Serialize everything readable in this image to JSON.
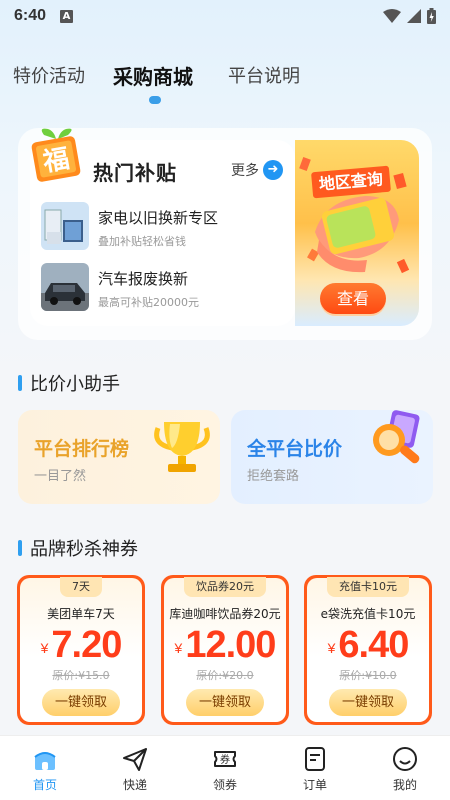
{
  "status_bar": {
    "time": "6:40",
    "badge": "A"
  },
  "tabs": [
    {
      "label": "特价活动"
    },
    {
      "label": "采购商城"
    },
    {
      "label": "平台说明"
    }
  ],
  "hot_subsidy": {
    "badge": "福",
    "title": "热门补贴",
    "more_label": "更多",
    "items": [
      {
        "title": "家电以旧换新专区",
        "subtitle": "叠加补贴轻松省钱"
      },
      {
        "title": "汽车报废换新",
        "subtitle": "最高可补贴20000元"
      }
    ],
    "region_title": "地区查询",
    "view_button": "查看"
  },
  "compare_section": {
    "title": "比价小助手",
    "cards": [
      {
        "title": "平台排行榜",
        "subtitle": "一目了然",
        "color": "#e9a32b"
      },
      {
        "title": "全平台比价",
        "subtitle": "拒绝套路",
        "color": "#2b84e8"
      }
    ]
  },
  "coupon_section": {
    "title": "品牌秒杀神券",
    "coupons": [
      {
        "tag": "7天",
        "name": "美团单车7天",
        "currency": "¥",
        "price": "7.20",
        "original": "原价:¥15.0",
        "button": "一键领取"
      },
      {
        "tag": "饮品券20元",
        "name": "库迪咖啡饮品券20元",
        "currency": "¥",
        "price": "12.00",
        "original": "原价:¥20.0",
        "button": "一键领取"
      },
      {
        "tag": "充值卡10元",
        "name": "e袋洗充值卡10元",
        "currency": "¥",
        "price": "6.40",
        "original": "原价:¥10.0",
        "button": "一键领取"
      }
    ]
  },
  "bottom_nav": [
    {
      "label": "首页",
      "icon": "home-icon",
      "active": true
    },
    {
      "label": "快递",
      "icon": "send-icon",
      "active": false
    },
    {
      "label": "领券",
      "icon": "coupon-icon",
      "active": false,
      "icon_text": "券"
    },
    {
      "label": "订单",
      "icon": "order-icon",
      "active": false
    },
    {
      "label": "我的",
      "icon": "profile-icon",
      "active": false
    }
  ],
  "colors": {
    "accent": "#2196f3",
    "coupon": "#ff5a1a",
    "price": "#ff3d1a"
  }
}
